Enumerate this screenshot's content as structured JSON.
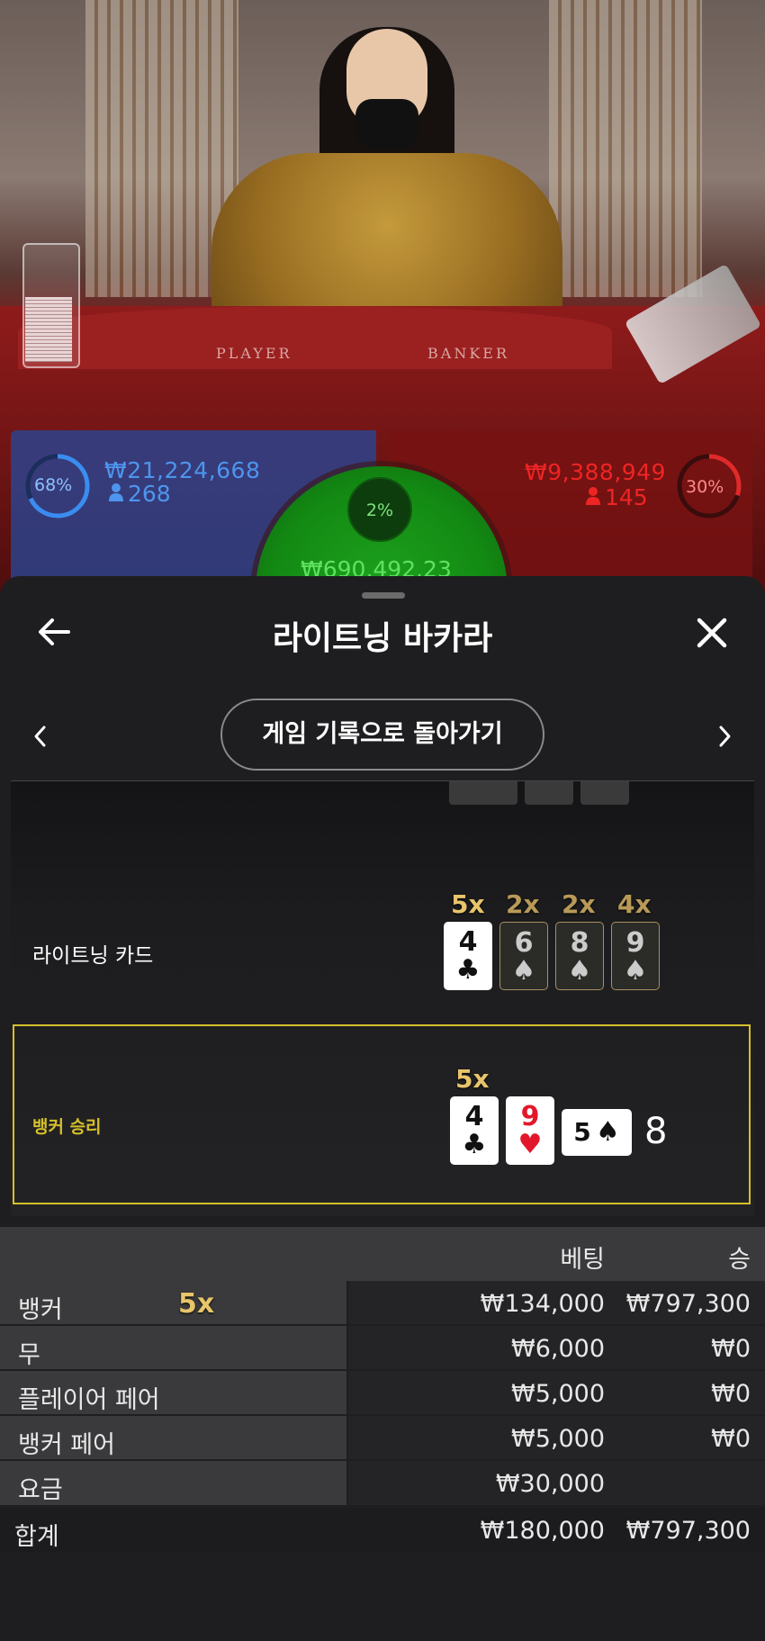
{
  "video": {
    "felt_labels": {
      "player": "PLAYER",
      "banker": "BANKER"
    }
  },
  "bet_stats": {
    "player": {
      "percent": "68%",
      "percent_value": 68,
      "amount": "₩21,224,668",
      "count": "268",
      "color": "#2f79d6"
    },
    "tie": {
      "percent": "2%",
      "percent_value": 2,
      "amount": "₩690,492.23",
      "color": "#37c837"
    },
    "banker": {
      "percent": "30%",
      "percent_value": 30,
      "amount": "₩9,388,949",
      "count": "145",
      "color": "#e02a2a"
    }
  },
  "sheet": {
    "title": "라이트닝 바카라",
    "back_to_history": "게임 기록으로 돌아가기",
    "icons": {
      "back": "arrow-left-icon",
      "close": "close-icon",
      "prev": "chevron-left-icon",
      "next": "chevron-right-icon"
    }
  },
  "lightning_cards": {
    "label": "라이트닝 카드",
    "cards": [
      {
        "multiplier": "5x",
        "rank": "4",
        "suit": "♣",
        "active": true
      },
      {
        "multiplier": "2x",
        "rank": "6",
        "suit": "♠",
        "active": false
      },
      {
        "multiplier": "2x",
        "rank": "8",
        "suit": "♠",
        "active": false
      },
      {
        "multiplier": "4x",
        "rank": "9",
        "suit": "♠",
        "active": false
      }
    ]
  },
  "result": {
    "label": "뱅커 승리",
    "multiplier": "5x",
    "cards": [
      {
        "rank": "4",
        "suit": "♣",
        "color": "black"
      },
      {
        "rank": "9",
        "suit": "♥",
        "color": "red"
      },
      {
        "rank": "5",
        "suit": "♠",
        "color": "black",
        "sideways": true
      }
    ],
    "score": "8",
    "highlight_color": "#d6c02a"
  },
  "bets_table": {
    "headers": {
      "bet": "베팅",
      "win": "승"
    },
    "rows": [
      {
        "label": "뱅커",
        "multiplier": "5x",
        "bet": "₩134,000",
        "win": "₩797,300"
      },
      {
        "label": "무",
        "bet": "₩6,000",
        "win": "₩0"
      },
      {
        "label": "플레이어 페어",
        "bet": "₩5,000",
        "win": "₩0"
      },
      {
        "label": "뱅커 페어",
        "bet": "₩5,000",
        "win": "₩0"
      },
      {
        "label": "요금",
        "bet": "₩30,000",
        "win": ""
      }
    ],
    "total": {
      "label": "합계",
      "bet": "₩180,000",
      "win": "₩797,300"
    }
  }
}
